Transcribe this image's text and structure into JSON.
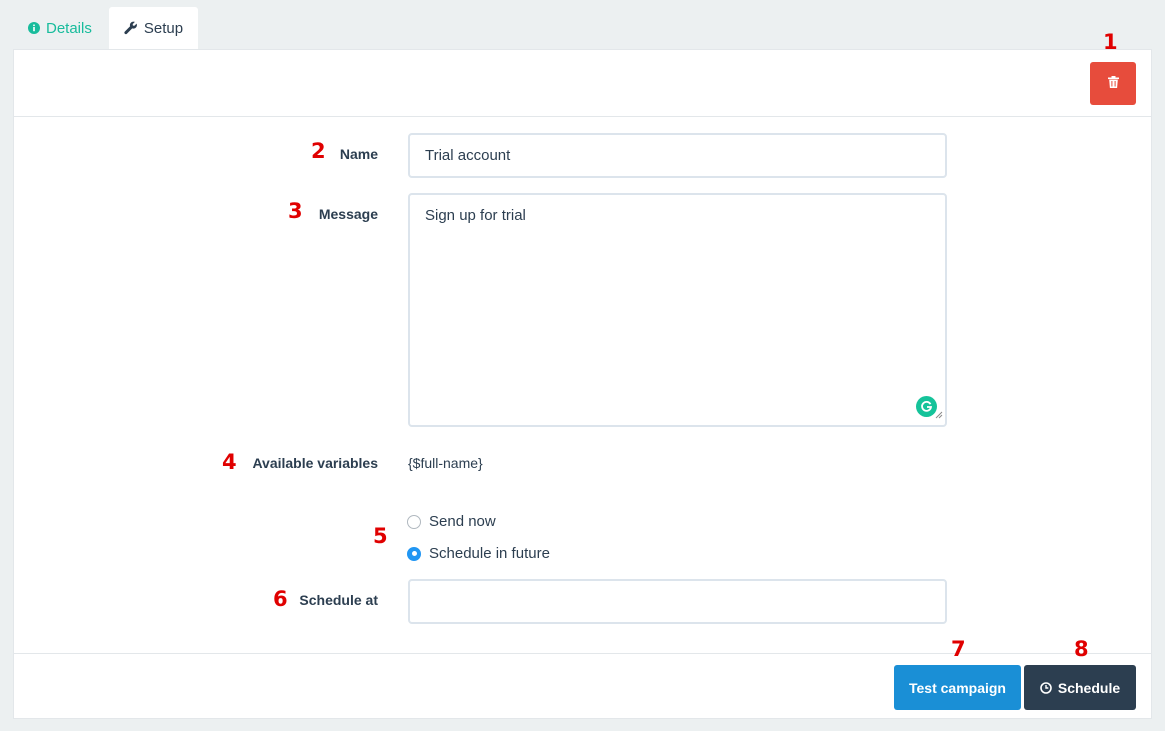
{
  "tabs": [
    {
      "label": "Details",
      "icon": "info-circle-icon",
      "active": false
    },
    {
      "label": "Setup",
      "icon": "wrench-icon",
      "active": true
    }
  ],
  "form": {
    "name_label": "Name",
    "name_value": "Trial account",
    "message_label": "Message",
    "message_value": "Sign up for trial",
    "variables_label": "Available variables",
    "variables_value": "{$full-name}",
    "radio_send_now": "Send now",
    "radio_schedule_future": "Schedule in future",
    "selected_option": "Schedule in future",
    "schedule_at_label": "Schedule at",
    "schedule_at_value": ""
  },
  "buttons": {
    "test_campaign": "Test campaign",
    "schedule": "Schedule"
  },
  "annotations": [
    "1",
    "2",
    "3",
    "4",
    "5",
    "6",
    "7",
    "8"
  ],
  "colors": {
    "accent_teal": "#18bc9c",
    "delete_red": "#e74c3c",
    "test_blue": "#1a8fd6",
    "schedule_dark": "#2c3e50",
    "annotation_red": "#e00000"
  }
}
